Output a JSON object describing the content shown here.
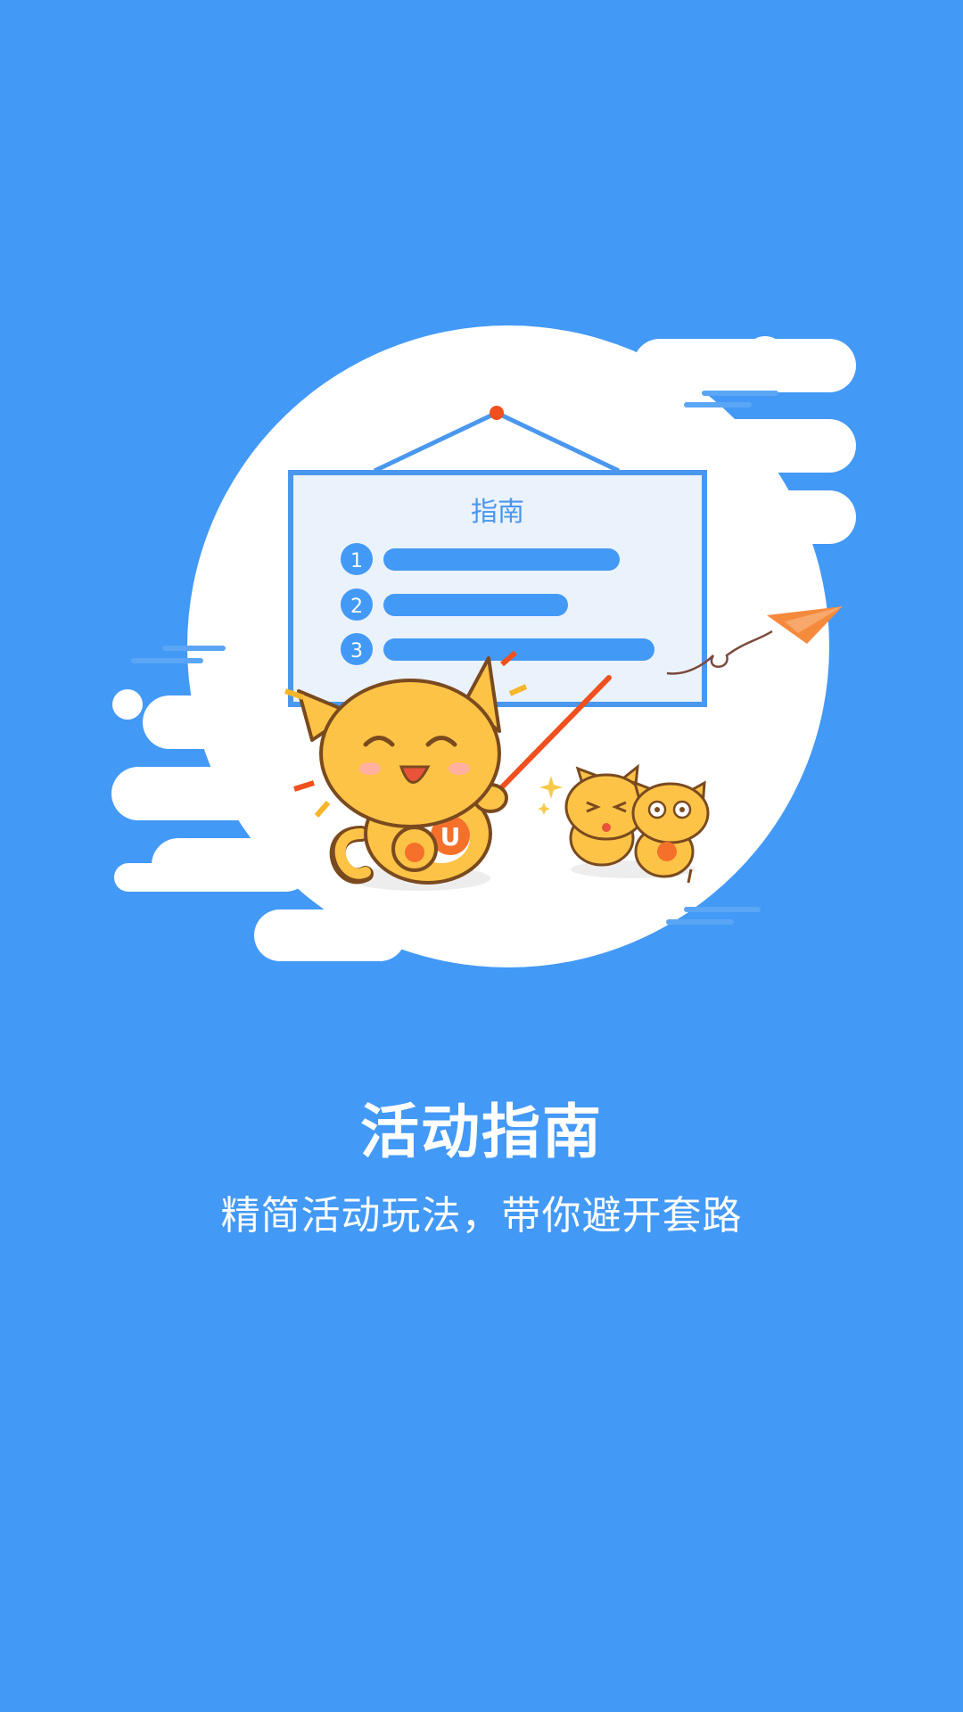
{
  "page": {
    "title": "活动指南",
    "subtitle": "精简活动玩法，带你避开套路"
  },
  "illustration": {
    "board_title": "指南",
    "steps": [
      "1",
      "2",
      "3"
    ],
    "badge_letter": "U"
  },
  "colors": {
    "background": "#4399F6",
    "board_border": "#4A97EE",
    "board_fill": "#EAF2FC",
    "bar": "#4399F6",
    "cat_body": "#FCC347",
    "cat_outline": "#7A4A1F",
    "pointer": "#F0501E",
    "paper_plane": "#F58A3D"
  },
  "icons": [
    "paper-plane-icon",
    "pushpin-icon",
    "sparkle-icon"
  ]
}
